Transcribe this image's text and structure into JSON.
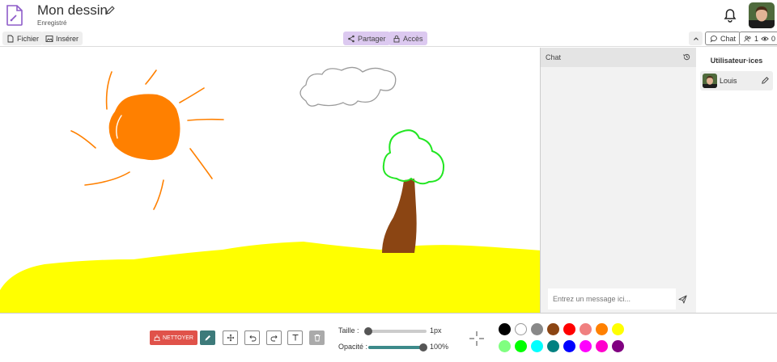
{
  "header": {
    "title": "Mon dessin",
    "status": "Enregistré"
  },
  "toolbar": {
    "file_label": "Fichier",
    "insert_label": "Insérer",
    "share_label": "Partager",
    "access_label": "Accès",
    "chat_label": "Chat",
    "users_count": "1",
    "viewers_count": "0"
  },
  "chat": {
    "title": "Chat",
    "input_placeholder": "Entrez un message ici..."
  },
  "users": {
    "title": "Utilisateur·ices",
    "list": [
      {
        "name": "Louis"
      }
    ]
  },
  "bottom": {
    "clear_label": "NETTOYER",
    "size_label": "Taille :",
    "size_value": "1px",
    "size_fraction": 0.0,
    "opacity_label": "Opacité :",
    "opacity_value": "100%",
    "opacity_fraction": 1.0
  },
  "palette": [
    "#000000",
    "#ffffff",
    "#888888",
    "#8b4513",
    "#ff0000",
    "#f08080",
    "#ff8000",
    "#ffff00",
    "#80ff80",
    "#00ff00",
    "#00ffff",
    "#008080",
    "#0000ff",
    "#ff00ff",
    "#ff00cc",
    "#800080"
  ],
  "colors": {
    "accent_purple": "#dcc9f0",
    "tool_active": "#3d7a7a",
    "clear_red": "#e0524a"
  }
}
